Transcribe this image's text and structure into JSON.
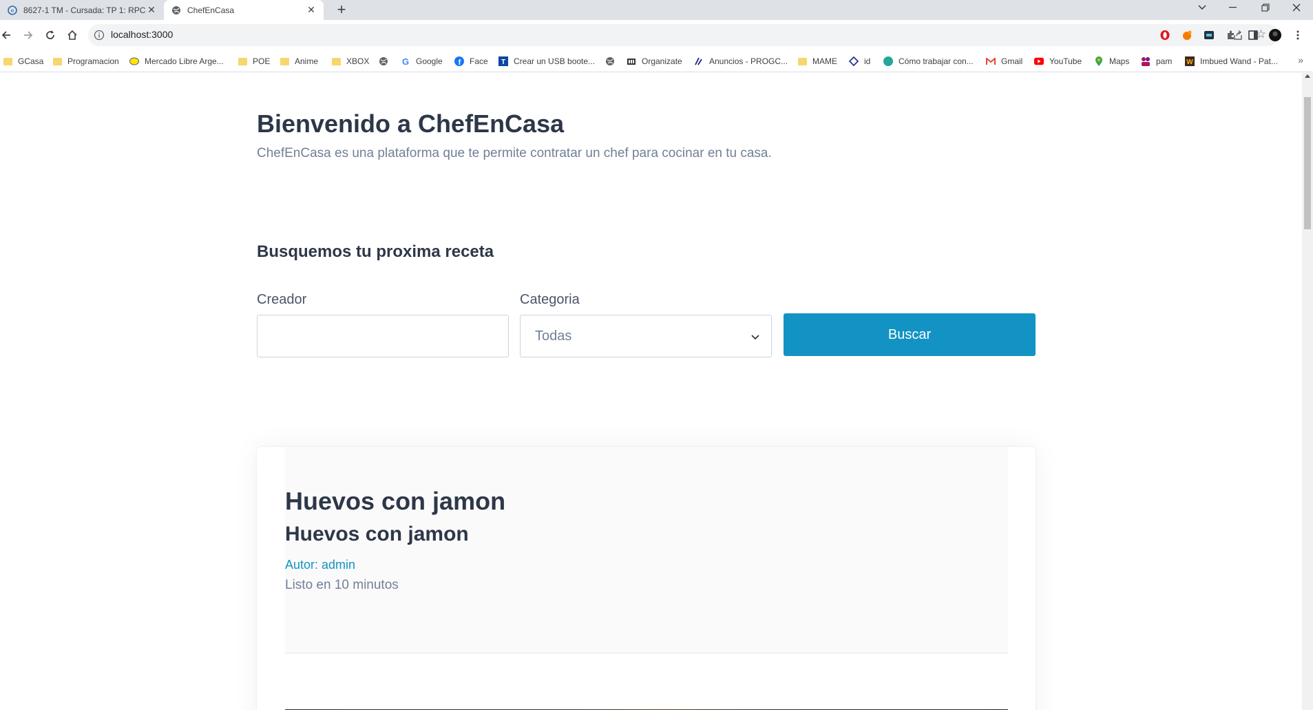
{
  "browser": {
    "tabs": [
      {
        "title": "8627-1 TM - Cursada: TP 1: RPC",
        "active": false
      },
      {
        "title": "ChefEnCasa",
        "active": true
      }
    ],
    "url": "localhost:3000",
    "bookmarks": [
      {
        "label": "GCasa",
        "icon": "folder-icon"
      },
      {
        "label": "Programacion",
        "icon": "folder-icon"
      },
      {
        "label": "Mercado Libre Arge...",
        "icon": "mercadolibre-icon"
      },
      {
        "label": "POE",
        "icon": "folder-icon"
      },
      {
        "label": "Anime",
        "icon": "folder-icon"
      },
      {
        "label": "XBOX",
        "icon": "folder-icon"
      },
      {
        "label": "",
        "icon": "globe-icon"
      },
      {
        "label": "Google",
        "icon": "google-icon"
      },
      {
        "label": "Face",
        "icon": "facebook-icon"
      },
      {
        "label": "Crear un USB boote...",
        "icon": "site-icon"
      },
      {
        "label": "",
        "icon": "globe-icon"
      },
      {
        "label": "Organizate",
        "icon": "organizate-icon"
      },
      {
        "label": "Anuncios - PROGC...",
        "icon": "site-icon"
      },
      {
        "label": "MAME",
        "icon": "folder-icon"
      },
      {
        "label": "id",
        "icon": "site-icon"
      },
      {
        "label": "Cómo trabajar con...",
        "icon": "site-icon"
      },
      {
        "label": "Gmail",
        "icon": "gmail-icon"
      },
      {
        "label": "YouTube",
        "icon": "youtube-icon"
      },
      {
        "label": "Maps",
        "icon": "maps-icon"
      },
      {
        "label": "pam",
        "icon": "site-icon"
      },
      {
        "label": "Imbued Wand - Pat...",
        "icon": "site-icon"
      }
    ]
  },
  "page": {
    "hero": {
      "title": "Bienvenido a ChefEnCasa",
      "subtitle": "ChefEnCasa es una plataforma que te permite contratar un chef para cocinar en tu casa."
    },
    "search": {
      "title": "Busquemos tu proxima receta",
      "creator_label": "Creador",
      "creator_value": "",
      "category_label": "Categoria",
      "category_selected": "Todas",
      "button_label": "Buscar"
    },
    "recipes": [
      {
        "title": "Huevos con jamon",
        "subtitle": "Huevos con jamon",
        "author": "Autor: admin",
        "ready_time": "Listo en 10 minutos"
      }
    ]
  },
  "colors": {
    "accent": "#1393c4",
    "heading": "#2d3748",
    "muted": "#718096"
  }
}
